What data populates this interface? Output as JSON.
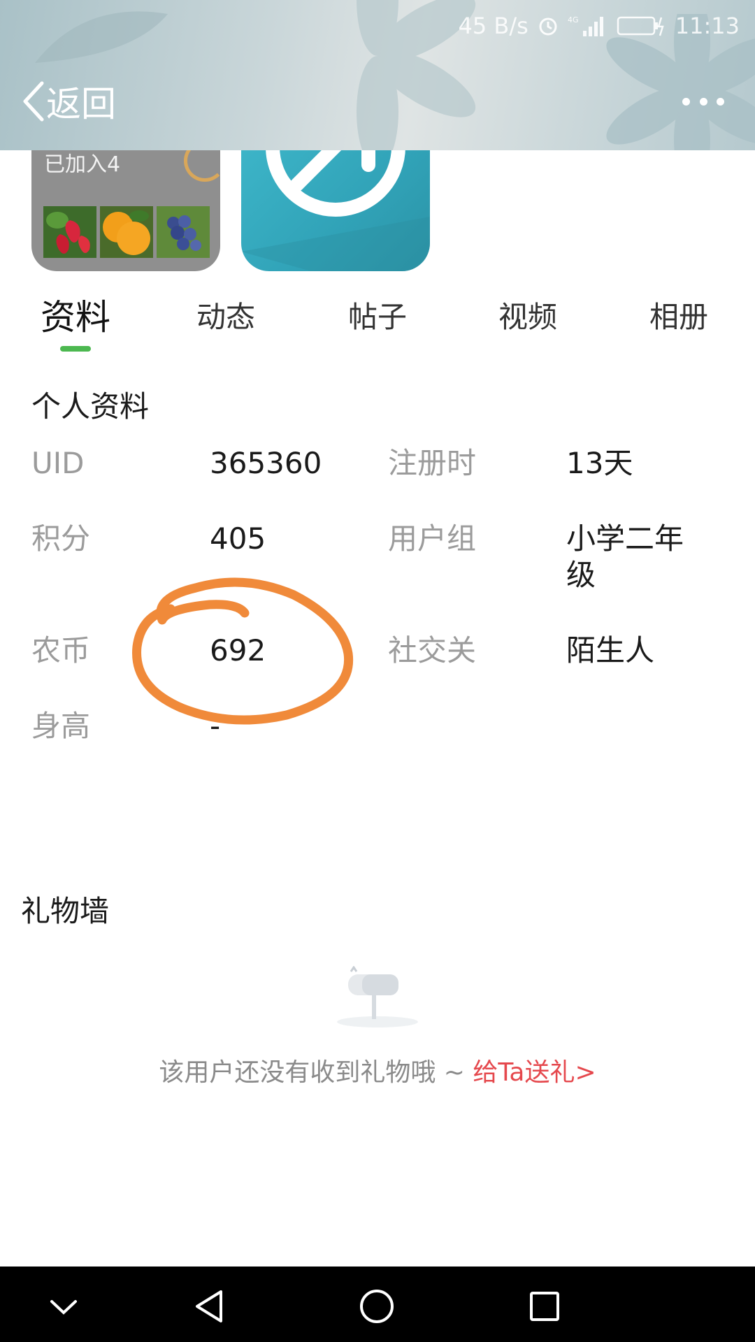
{
  "status_bar": {
    "net_speed": "45 B/s",
    "network": "4G",
    "battery": "11",
    "time": "11:13"
  },
  "header": {
    "back_label": "返回",
    "back_icon": "chevron-left-icon",
    "more_icon": "more-dots-icon"
  },
  "cards": {
    "group_joined": "已加入4"
  },
  "tabs": [
    {
      "label": "资料",
      "active": true
    },
    {
      "label": "动态",
      "active": false
    },
    {
      "label": "帖子",
      "active": false
    },
    {
      "label": "视频",
      "active": false
    },
    {
      "label": "相册",
      "active": false
    }
  ],
  "profile": {
    "title": "个人资料",
    "fields": [
      {
        "label": "UID",
        "value": "365360"
      },
      {
        "label": "注册时",
        "value": "13天"
      },
      {
        "label": "积分",
        "value": "405"
      },
      {
        "label": "用户组",
        "value": "小学二年级"
      },
      {
        "label": "农币",
        "value": "692"
      },
      {
        "label": "社交关",
        "value": "陌生人"
      },
      {
        "label": "身高",
        "value": "-"
      }
    ],
    "annotation_color": "#f08a3a"
  },
  "gift_wall": {
    "title": "礼物墙",
    "empty_text": "该用户还没有收到礼物哦 ~ ",
    "link_text": "给Ta送礼>",
    "link_color": "#e5484d"
  },
  "nav": {
    "items": [
      "chevron-down-icon",
      "back-triangle-icon",
      "home-circle-icon",
      "recent-square-icon"
    ]
  },
  "colors": {
    "accent_green": "#4cb850",
    "app_icon_teal": "#36aec2",
    "nav_background": "#000000"
  }
}
